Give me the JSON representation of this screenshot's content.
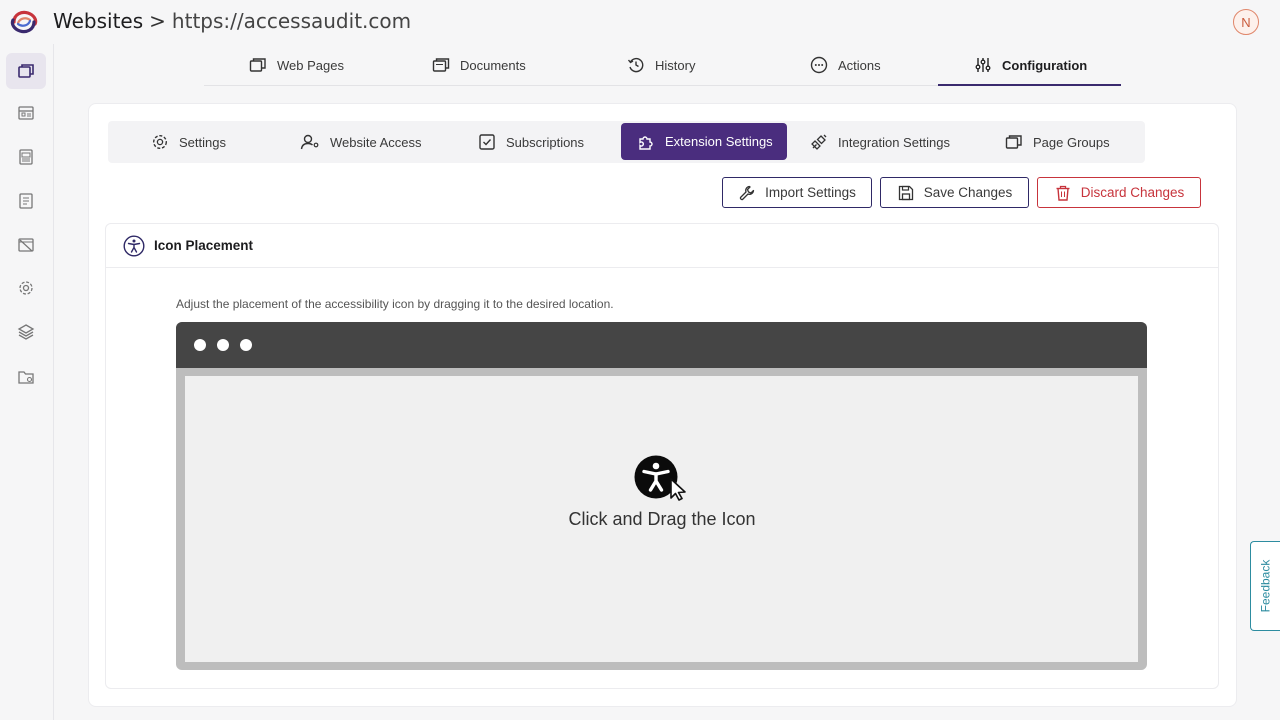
{
  "header": {
    "title": "Websites",
    "separator": ">",
    "url": "https://accessaudit.com",
    "avatar_initial": "N"
  },
  "sidebar": {
    "items": [
      {
        "icon": "pages-icon",
        "active": true
      },
      {
        "icon": "table-icon"
      },
      {
        "icon": "report-icon"
      },
      {
        "icon": "document-icon"
      },
      {
        "icon": "no-image-icon"
      },
      {
        "icon": "gear-icon"
      },
      {
        "icon": "layers-icon"
      },
      {
        "icon": "folder-settings-icon"
      }
    ]
  },
  "main_tabs": [
    {
      "label": "Web Pages",
      "icon": "pages-icon"
    },
    {
      "label": "Documents",
      "icon": "documents-icon"
    },
    {
      "label": "History",
      "icon": "history-icon"
    },
    {
      "label": "Actions",
      "icon": "more-circle-icon"
    },
    {
      "label": "Configuration",
      "icon": "sliders-icon",
      "active": true
    }
  ],
  "sub_tabs": [
    {
      "label": "Settings",
      "icon": "gear-icon"
    },
    {
      "label": "Website Access",
      "icon": "user-access-icon"
    },
    {
      "label": "Subscriptions",
      "icon": "checkbox-icon"
    },
    {
      "label": "Extension Settings",
      "icon": "puzzle-icon",
      "active": true
    },
    {
      "label": "Integration Settings",
      "icon": "plug-icon"
    },
    {
      "label": "Page Groups",
      "icon": "pages-icon"
    }
  ],
  "actions": {
    "import": "Import Settings",
    "save": "Save Changes",
    "discard": "Discard Changes"
  },
  "panel": {
    "title": "Icon Placement",
    "description": "Adjust the placement of the accessibility icon by dragging it to the desired location.",
    "drag_text": "Click and Drag the Icon"
  },
  "feedback": "Feedback",
  "colors": {
    "accent": "#4a2d7e",
    "navy": "#2f2966",
    "danger": "#c7343c",
    "feedback": "#2d8ca0"
  }
}
